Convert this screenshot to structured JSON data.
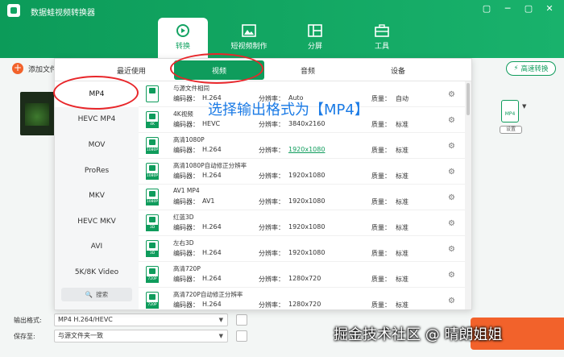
{
  "app": {
    "title": "数据蛙视频转换器"
  },
  "window": {
    "restore": "▢",
    "minimize": "─",
    "maximize": "▢",
    "close": "✕"
  },
  "nav": [
    {
      "label": "转换",
      "icon": "convert-icon"
    },
    {
      "label": "短视频制作",
      "icon": "image-icon"
    },
    {
      "label": "分屏",
      "icon": "split-screen-icon"
    },
    {
      "label": "工具",
      "icon": "toolbox-icon"
    }
  ],
  "toolbar": {
    "add_label": "添加文件",
    "fast_convert_label": "高速转换"
  },
  "file": {
    "format_badge": "MP4",
    "settings_label": "设置"
  },
  "format_tabs": [
    "最近使用",
    "视频",
    "音频",
    "设备"
  ],
  "categories": [
    "MP4",
    "HEVC MP4",
    "MOV",
    "ProRes",
    "MKV",
    "HEVC MKV",
    "AVI",
    "5K/8K Video"
  ],
  "search_label": "搜索",
  "labels": {
    "codec": "编码器：",
    "resolution": "分辨率：",
    "quality": "质量："
  },
  "presets": [
    {
      "name": "与源文件相同",
      "tag": "",
      "codec": "H.264",
      "resolution": "Auto",
      "quality": "自动"
    },
    {
      "name": "4K视频",
      "tag": "4K",
      "codec": "HEVC",
      "resolution": "3840x2160",
      "quality": "标准"
    },
    {
      "name": "高清1080P",
      "tag": "1080P",
      "codec": "H.264",
      "resolution": "1920x1080",
      "quality": "标准"
    },
    {
      "name": "高清1080P自动修正分辨率",
      "tag": "1080P",
      "codec": "H.264",
      "resolution": "1920x1080",
      "quality": "标准"
    },
    {
      "name": "AV1 MP4",
      "tag": "1080P",
      "codec": "AV1",
      "resolution": "1920x1080",
      "quality": "标准"
    },
    {
      "name": "红蓝3D",
      "tag": "3D",
      "codec": "H.264",
      "resolution": "1920x1080",
      "quality": "标准"
    },
    {
      "name": "左右3D",
      "tag": "3D",
      "codec": "H.264",
      "resolution": "1920x1080",
      "quality": "标准"
    },
    {
      "name": "高清720P",
      "tag": "720P",
      "codec": "H.264",
      "resolution": "1280x720",
      "quality": "标准"
    },
    {
      "name": "高清720P自动修正分辨率",
      "tag": "720P",
      "codec": "H.264",
      "resolution": "1280x720",
      "quality": "标准"
    }
  ],
  "output": {
    "format_label": "输出格式:",
    "format_value": "MP4 H.264/HEVC",
    "save_label": "保存至:",
    "save_value": "与源文件夹一致"
  },
  "annotation": "选择输出格式为【MP4】",
  "watermark": "掘金技术社区 @ 晴朗姐姐"
}
